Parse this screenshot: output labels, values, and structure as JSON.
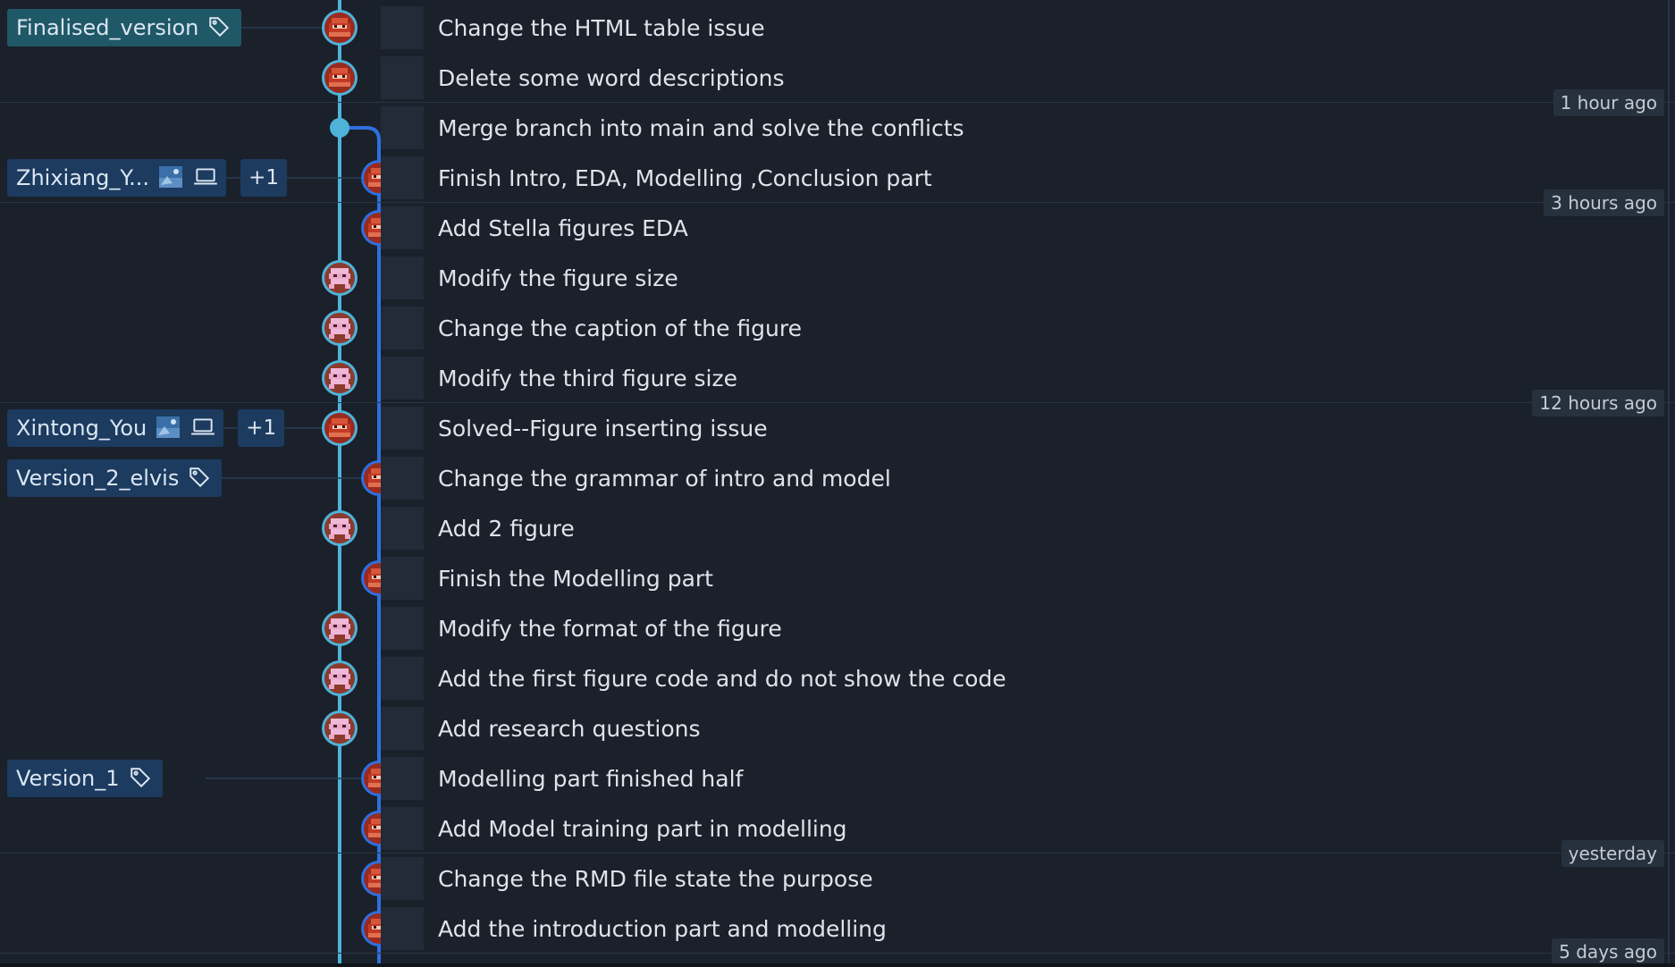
{
  "colors": {
    "background": "#1a212b",
    "branch_main": "#4fb3d9",
    "branch_side": "#2f6fe0",
    "ref_badge": "#1c3b5f",
    "ref_badge_current": "#1f5867"
  },
  "commits": [
    {
      "message": "Change the HTML table issue",
      "lane": 0,
      "avatar": "red-avatar-icon",
      "refs": [
        {
          "label": "Finalised_version",
          "icon": "tag-icon",
          "current": true
        }
      ]
    },
    {
      "message": "Delete some word descriptions",
      "lane": 0,
      "avatar": "red-avatar-icon",
      "refs": []
    },
    {
      "message": "Merge branch into main and solve the conflicts",
      "lane": 0,
      "avatar": "merge-dot",
      "refs": []
    },
    {
      "message": "Finish Intro, EDA, Modelling ,Conclusion part",
      "lane": 1,
      "avatar": "red-avatar-icon",
      "refs": [
        {
          "label": "Zhixiang_Y...",
          "icons": [
            "remote-avatar-icon",
            "laptop-icon"
          ],
          "extra": "+1"
        }
      ]
    },
    {
      "message": "Add Stella figures EDA",
      "lane": 1,
      "avatar": "red-avatar-icon",
      "refs": []
    },
    {
      "message": "Modify the figure size",
      "lane": 0,
      "avatar": "pink-avatar-icon",
      "refs": []
    },
    {
      "message": "Change the caption of the figure",
      "lane": 0,
      "avatar": "pink-avatar-icon",
      "refs": []
    },
    {
      "message": "Modify the third figure size",
      "lane": 0,
      "avatar": "pink-avatar-icon",
      "refs": []
    },
    {
      "message": "Solved--Figure inserting issue",
      "lane": 0,
      "avatar": "red-avatar-icon",
      "refs": [
        {
          "label": "Xintong_You",
          "icons": [
            "remote-avatar-icon",
            "laptop-icon"
          ],
          "extra": "+1"
        }
      ]
    },
    {
      "message": "Change the grammar of intro and model",
      "lane": 1,
      "avatar": "red-avatar-icon",
      "refs": [
        {
          "label": "Version_2_elvis",
          "icon": "tag-icon"
        }
      ]
    },
    {
      "message": "Add 2 figure",
      "lane": 0,
      "avatar": "pink-avatar-icon",
      "refs": []
    },
    {
      "message": "Finish the Modelling part",
      "lane": 1,
      "avatar": "red-avatar-icon",
      "refs": []
    },
    {
      "message": "Modify the format of the figure",
      "lane": 0,
      "avatar": "pink-avatar-icon",
      "refs": []
    },
    {
      "message": "Add the first figure code and do not show the code",
      "lane": 0,
      "avatar": "pink-avatar-icon",
      "refs": []
    },
    {
      "message": "Add research questions",
      "lane": 0,
      "avatar": "pink-avatar-icon",
      "refs": []
    },
    {
      "message": "Modelling part finished half",
      "lane": 1,
      "avatar": "red-avatar-icon",
      "refs": [
        {
          "label": "Version_1",
          "icon": "tag-icon"
        }
      ]
    },
    {
      "message": "Add Model training part in modelling",
      "lane": 1,
      "avatar": "red-avatar-icon",
      "refs": []
    },
    {
      "message": "Change the RMD file state the purpose",
      "lane": 1,
      "avatar": "red-avatar-icon",
      "refs": []
    },
    {
      "message": "Add the introduction part and modelling",
      "lane": 1,
      "avatar": "red-avatar-icon",
      "refs": []
    }
  ],
  "time_separators": [
    {
      "label": "1 hour ago",
      "after_row": 1
    },
    {
      "label": "3 hours ago",
      "after_row": 3
    },
    {
      "label": "12 hours ago",
      "after_row": 7
    },
    {
      "label": "yesterday",
      "after_row": 16
    },
    {
      "label": "5 days ago",
      "after_row": 18
    }
  ]
}
